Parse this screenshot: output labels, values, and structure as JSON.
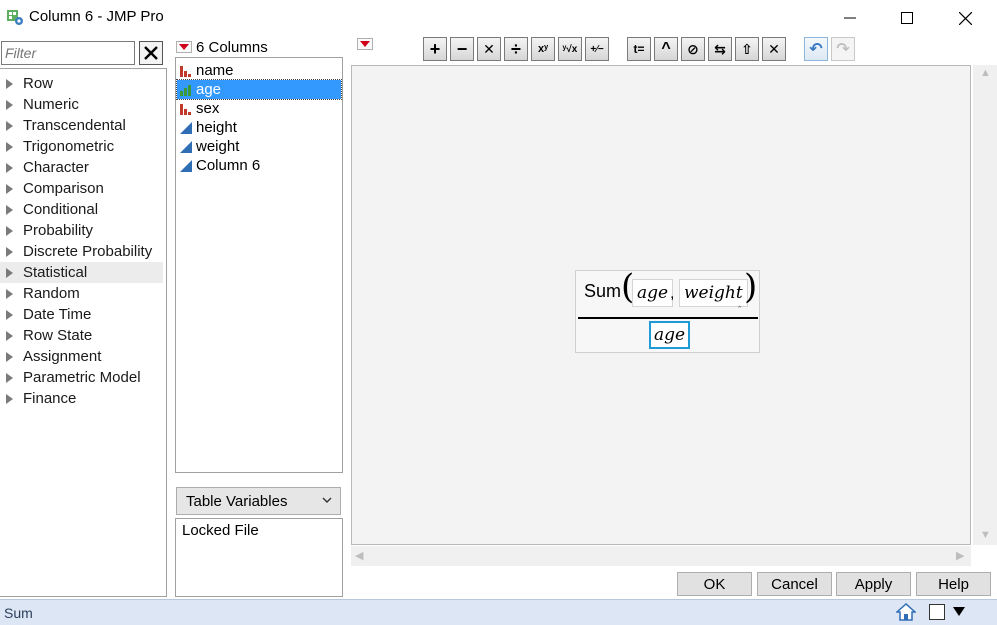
{
  "window": {
    "title": "Column 6 - JMP Pro",
    "minimize_glyph": "—",
    "maximize_glyph": "☐",
    "close_glyph": "✕"
  },
  "filter": {
    "placeholder": "Filter",
    "clear_glyph": "✕"
  },
  "functions": [
    {
      "label": "Row",
      "selected": false
    },
    {
      "label": "Numeric",
      "selected": false
    },
    {
      "label": "Transcendental",
      "selected": false
    },
    {
      "label": "Trigonometric",
      "selected": false
    },
    {
      "label": "Character",
      "selected": false
    },
    {
      "label": "Comparison",
      "selected": false
    },
    {
      "label": "Conditional",
      "selected": false
    },
    {
      "label": "Probability",
      "selected": false
    },
    {
      "label": "Discrete Probability",
      "selected": false
    },
    {
      "label": "Statistical",
      "selected": true
    },
    {
      "label": "Random",
      "selected": false
    },
    {
      "label": "Date Time",
      "selected": false
    },
    {
      "label": "Row State",
      "selected": false
    },
    {
      "label": "Assignment",
      "selected": false
    },
    {
      "label": "Parametric Model",
      "selected": false
    },
    {
      "label": "Finance",
      "selected": false
    }
  ],
  "columns_panel": {
    "header": "6 Columns",
    "items": [
      {
        "label": "name",
        "icon": "nominal-icon",
        "selected": false
      },
      {
        "label": "age",
        "icon": "ordinal-icon",
        "selected": true
      },
      {
        "label": "sex",
        "icon": "nominal-icon",
        "selected": false
      },
      {
        "label": "height",
        "icon": "continuous-icon",
        "selected": false
      },
      {
        "label": "weight",
        "icon": "continuous-icon",
        "selected": false
      },
      {
        "label": "Column 6",
        "icon": "continuous-icon",
        "selected": false
      }
    ]
  },
  "table_variables": {
    "dropdown_label": "Table Variables",
    "items": [
      "Locked File"
    ]
  },
  "toolbar": {
    "buttons": [
      {
        "name": "add-button",
        "glyph": "+"
      },
      {
        "name": "subtract-button",
        "glyph": "−"
      },
      {
        "name": "multiply-button",
        "glyph": "✕"
      },
      {
        "name": "divide-button",
        "glyph": "÷"
      },
      {
        "name": "power-button",
        "glyph": "xʸ"
      },
      {
        "name": "root-button",
        "glyph": "ʸ√x"
      },
      {
        "name": "sign-button",
        "glyph": "+∕−"
      },
      {
        "name": "assign-button",
        "glyph": "t="
      },
      {
        "name": "caret-up-button",
        "glyph": "^"
      },
      {
        "name": "peel-button",
        "glyph": "⊘"
      },
      {
        "name": "swap-button",
        "glyph": "⇆"
      },
      {
        "name": "unary-button",
        "glyph": "⇧"
      },
      {
        "name": "delete-button",
        "glyph": "✕"
      },
      {
        "name": "undo-button",
        "glyph": "↶"
      },
      {
        "name": "redo-button",
        "glyph": "↷"
      }
    ]
  },
  "formula": {
    "function_name": "Sum",
    "open_paren": "(",
    "close_paren": ")",
    "arg1": "age",
    "separator": ",",
    "arg2": "weight",
    "insert_caret": "‸",
    "denominator": "age"
  },
  "buttons": {
    "ok": "OK",
    "cancel": "Cancel",
    "apply": "Apply",
    "help": "Help"
  },
  "status": {
    "text": "Sum"
  },
  "colors": {
    "selection": "#3399ff",
    "status_bg": "#dce6f4",
    "focus_border": "#1f9bd7",
    "nominal_red": "#c0392b",
    "continuous_blue": "#2f6db5"
  }
}
